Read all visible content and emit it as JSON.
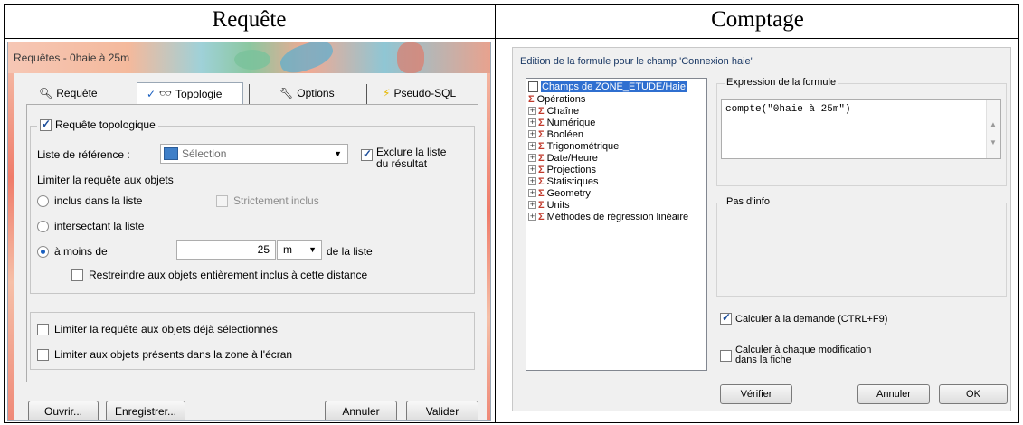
{
  "columns": {
    "left_title": "Requête",
    "right_title": "Comptage"
  },
  "requete": {
    "window_title": "Requêtes - 0haie à 25m",
    "tabs": [
      {
        "label": "Requête",
        "icon": "magnifier-icon"
      },
      {
        "label": "Topologie",
        "icon": "binoculars-icon"
      },
      {
        "label": "Options",
        "icon": "wrench-icon"
      },
      {
        "label": "Pseudo-SQL",
        "icon": "lightning-icon"
      }
    ],
    "topo_check_label": "Requête topologique",
    "liste_ref_label": "Liste de référence :",
    "liste_ref_value": "Sélection",
    "exclure_label_1": "Exclure la liste",
    "exclure_label_2": "du résultat",
    "limiter_label": "Limiter la requête aux objets",
    "radio_inclus": "inclus dans la liste",
    "strictement_label": "Strictement inclus",
    "radio_intersectant": "intersectant la liste",
    "radio_moins": "à moins de",
    "distance_value": "25",
    "unit_value": "m",
    "de_la_liste": "de la liste",
    "restreindre_label": "Restreindre aux objets entièrement inclus à cette distance",
    "limit_selected_label": "Limiter la requête aux objets déjà sélectionnés",
    "limit_screen_label": "Limiter aux objets présents dans la zone à l'écran",
    "buttons": {
      "ouvrir": "Ouvrir...",
      "enregistrer": "Enregistrer...",
      "annuler": "Annuler",
      "valider": "Valider"
    }
  },
  "comptage": {
    "dialog_title": "Edition de la formule pour le champ 'Connexion haie'",
    "tree": [
      "Champs de ZONE_ETUDE/Haie",
      "Opérations",
      "Chaîne",
      "Numérique",
      "Booléen",
      "Trigonométrique",
      "Date/Heure",
      "Projections",
      "Statistiques",
      "Geometry",
      "Units",
      "Méthodes de régression linéaire"
    ],
    "expression_label": "Expression de la formule",
    "expression_value": "compte(\"0haie à 25m\")",
    "info_label": "Pas d'info",
    "calc_demand_label": "Calculer à la demande (CTRL+F9)",
    "calc_modif_label_1": "Calculer à chaque modification",
    "calc_modif_label_2": "dans la fiche",
    "buttons": {
      "verifier": "Vérifier",
      "annuler": "Annuler",
      "ok": "OK"
    }
  }
}
